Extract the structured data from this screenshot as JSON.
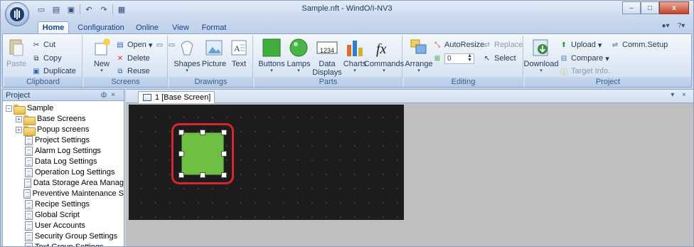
{
  "window": {
    "title": "Sample.nft - WindO/I-NV3",
    "controls": {
      "minimize": "–",
      "maximize": "□",
      "close": "x"
    }
  },
  "quick_access": [
    "new-icon",
    "open-icon",
    "save-icon",
    "undo-icon",
    "redo-icon",
    "screen-icon"
  ],
  "tabs": [
    {
      "label": "Home",
      "active": true
    },
    {
      "label": "Configuration",
      "active": false
    },
    {
      "label": "Online",
      "active": false
    },
    {
      "label": "View",
      "active": false
    },
    {
      "label": "Format",
      "active": false
    }
  ],
  "ribbon": {
    "clipboard": {
      "caption": "Clipboard",
      "paste": "Paste",
      "cut": "Cut",
      "copy": "Copy",
      "duplicate": "Duplicate"
    },
    "screens": {
      "caption": "Screens",
      "new": "New",
      "open": "Open",
      "delete": "Delete",
      "reuse": "Reuse"
    },
    "drawings": {
      "caption": "Drawings",
      "shapes": "Shapes",
      "picture": "Picture",
      "text": "Text"
    },
    "parts": {
      "caption": "Parts",
      "buttons": "Buttons",
      "lamps": "Lamps",
      "data_displays": "Data\nDisplays",
      "charts": "Charts",
      "commands": "Commands",
      "data_display_sample": "1234"
    },
    "editing": {
      "caption": "Editing",
      "arrange": "Arrange",
      "autoresize": "AutoResize",
      "replace": "Replace",
      "select": "Select",
      "spin_value": "0"
    },
    "project": {
      "caption": "Project",
      "download": "Download",
      "upload": "Upload",
      "compare": "Compare",
      "target_info": "Target Info.",
      "comm_setup": "Comm.Setup"
    }
  },
  "project_panel": {
    "title": "Project",
    "pin": "ф",
    "close": "×",
    "tree": [
      {
        "label": "Sample",
        "type": "folder",
        "level": 0,
        "expander": "−"
      },
      {
        "label": "Base Screens",
        "type": "folder",
        "level": 1,
        "expander": "+"
      },
      {
        "label": "Popup screens",
        "type": "folder",
        "level": 1,
        "expander": "+"
      },
      {
        "label": "Project Settings",
        "type": "doc",
        "level": 1
      },
      {
        "label": "Alarm Log Settings",
        "type": "doc",
        "level": 1
      },
      {
        "label": "Data Log Settings",
        "type": "doc",
        "level": 1
      },
      {
        "label": "Operation Log Settings",
        "type": "doc",
        "level": 1
      },
      {
        "label": "Data Storage Area Manag",
        "type": "doc",
        "level": 1
      },
      {
        "label": "Preventive Maintenance S",
        "type": "doc",
        "level": 1
      },
      {
        "label": "Recipe Settings",
        "type": "doc",
        "level": 1
      },
      {
        "label": "Global Script",
        "type": "doc",
        "level": 1
      },
      {
        "label": "User Accounts",
        "type": "doc",
        "level": 1
      },
      {
        "label": "Security Group Settings",
        "type": "doc",
        "level": 1
      },
      {
        "label": "Text Group Settings",
        "type": "doc",
        "level": 1
      }
    ]
  },
  "document": {
    "tab_label": "1  [Base Screen]",
    "tab_controls": "▾ ×"
  },
  "colors": {
    "canvas": "#1d1d1d",
    "lamp": "#6fbf43",
    "highlight": "#d9262b"
  }
}
